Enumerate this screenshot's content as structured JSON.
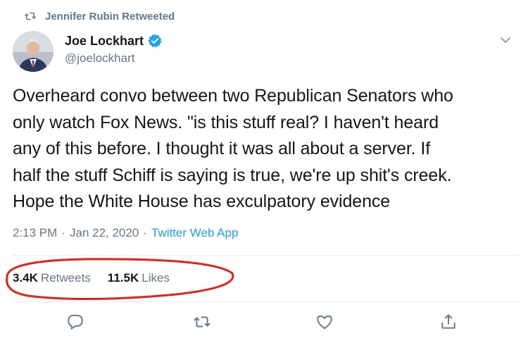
{
  "retweet_context": {
    "text": "Jennifer Rubin Retweeted"
  },
  "author": {
    "name": "Joe Lockhart",
    "handle": "@joelockhart"
  },
  "tweet": {
    "text": "Overheard convo between two Republican Senators who\nonly watch Fox News. \"is this stuff real? I haven't heard\nany of this before. I thought it was all about a server.  If\nhalf the stuff Schiff is saying is true, we're up shit's creek.\nHope the White House has exculpatory evidence",
    "time": "2:13 PM",
    "date": "Jan 22, 2020",
    "separator": "·",
    "source": "Twitter Web App"
  },
  "stats": {
    "retweets_count": "3.4K",
    "retweets_label": "Retweets",
    "likes_count": "11.5K",
    "likes_label": "Likes"
  },
  "actions": [
    "reply-icon",
    "retweet-icon",
    "like-icon",
    "share-icon"
  ],
  "colors": {
    "text": "#14171a",
    "secondary": "#657786",
    "link": "#1da1f2",
    "divider": "#e6ecf0",
    "highlight": "#e0241b"
  }
}
